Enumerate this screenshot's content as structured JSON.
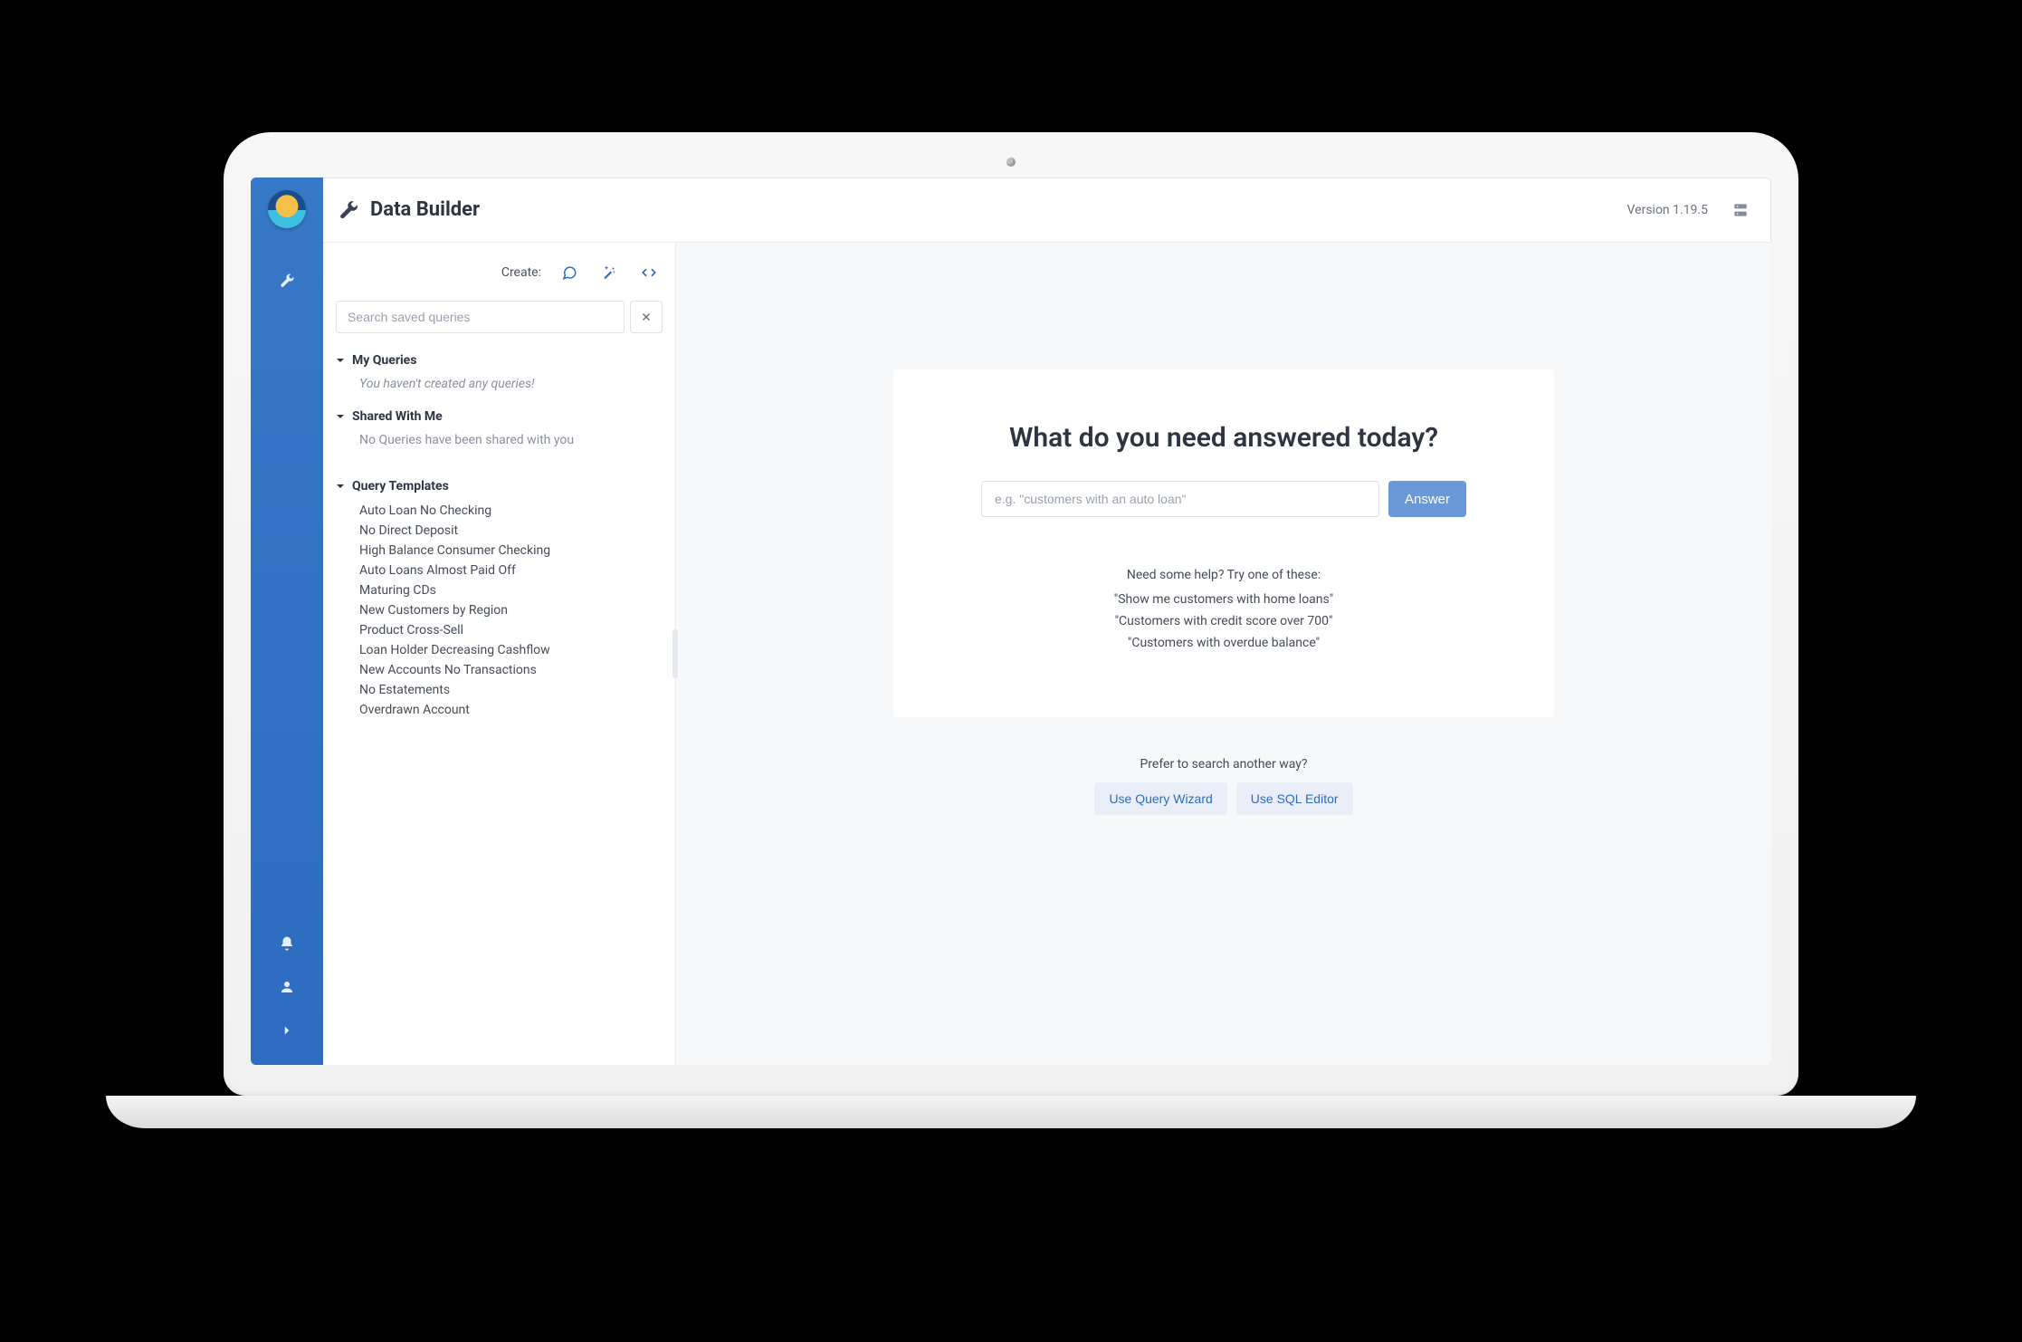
{
  "header": {
    "title": "Data Builder",
    "version": "Version 1.19.5"
  },
  "panel": {
    "create_label": "Create:",
    "search_placeholder": "Search saved queries",
    "sections": {
      "my_queries": {
        "heading": "My Queries",
        "empty": "You haven't created any queries!"
      },
      "shared": {
        "heading": "Shared With Me",
        "info": "No Queries have been shared with you"
      },
      "templates": {
        "heading": "Query Templates",
        "items": [
          "Auto Loan No Checking",
          "No Direct Deposit",
          "High Balance Consumer Checking",
          "Auto Loans Almost Paid Off",
          "Maturing CDs",
          "New Customers by Region",
          "Product Cross-Sell",
          "Loan Holder Decreasing Cashflow",
          "New Accounts No Transactions",
          "No Estatements",
          "Overdrawn Account"
        ]
      }
    }
  },
  "main": {
    "question": "What do you need answered today?",
    "ask_placeholder": "e.g. \"customers with an auto loan\"",
    "answer_label": "Answer",
    "help_title": "Need some help? Try one of these:",
    "help_examples": [
      "\"Show me customers with home loans\"",
      "\"Customers with credit score over 700\"",
      "\"Customers with overdue balance\""
    ],
    "prefer_title": "Prefer to search another way?",
    "use_query_wizard": "Use Query Wizard",
    "use_sql_editor": "Use SQL Editor"
  }
}
